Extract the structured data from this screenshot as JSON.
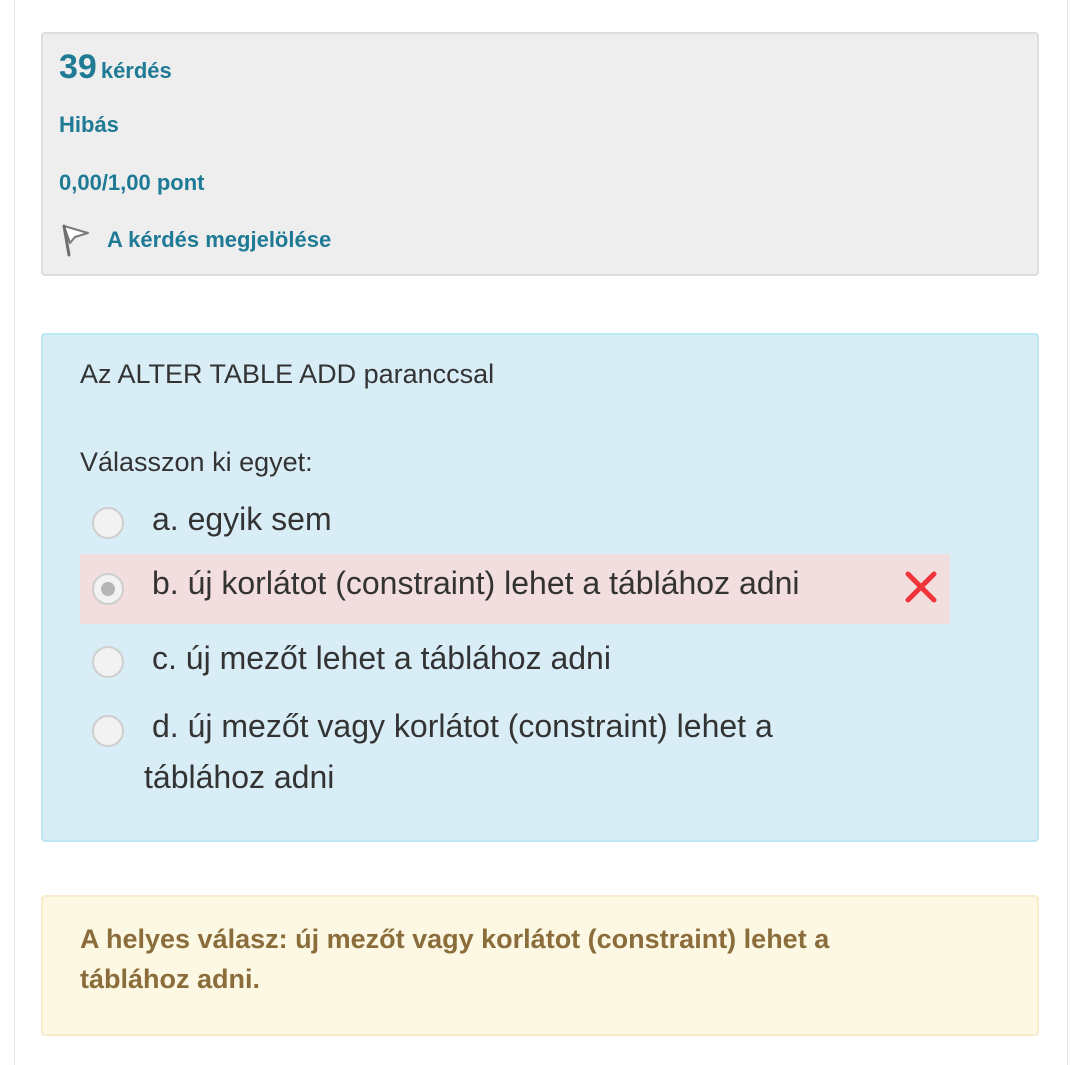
{
  "info": {
    "question_number": "39",
    "question_word": "kérdés",
    "state": "Hibás",
    "grade": "0,00/1,00 pont",
    "flag_label": "A kérdés megjelölése",
    "flag_icon": "flag-icon"
  },
  "question": {
    "text": "Az ALTER TABLE ADD paranccsal",
    "prompt": "Válasszon ki egyet:",
    "answers": [
      {
        "label": "a. egyik sem",
        "selected": false
      },
      {
        "label": "b. új korlátot (constraint) lehet a táblához adni",
        "selected": true,
        "status_icon": "incorrect-icon"
      },
      {
        "label": "c. új mezőt lehet a táblához adni",
        "selected": false
      },
      {
        "label": "d. új mezőt vagy korlátot (constraint) lehet a táblához adni",
        "selected": false
      }
    ]
  },
  "feedback": {
    "right_answer": "A helyes válasz: új mezőt vagy korlátot (constraint) lehet a táblához adni."
  },
  "colors": {
    "link": "#1f7a95",
    "info_bg": "#eeeeee",
    "question_bg": "#d9edf7",
    "incorrect_bg": "#f2dede",
    "incorrect_mark": "#f0343a",
    "feedback_bg": "#fcf8e3",
    "feedback_text": "#8a6d3b"
  }
}
